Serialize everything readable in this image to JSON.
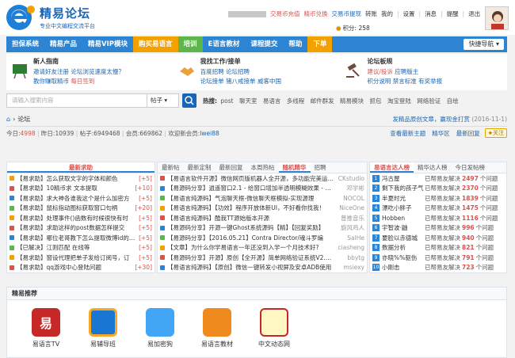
{
  "site": {
    "name": "精易论坛",
    "badge": "易",
    "tagline": "专业中文编程交流平台"
  },
  "toplinks": {
    "charge": "交易币充值",
    "exchange": "精币兑换",
    "rewards": "交易币提现",
    "label_switch": "转账",
    "mine": "我的",
    "settings": "设置",
    "messages": "消息",
    "remind": "提醒",
    "logout": "退出",
    "credits_label": "积分: 258"
  },
  "nav": [
    "担保系统",
    "精易产品",
    "精易VIP模块",
    "购买易语言",
    "培训",
    "E语言教材",
    "课程提交",
    "帮助",
    "下单"
  ],
  "quicknav": "快捷导航",
  "features": [
    {
      "title": "新人指南",
      "rows": [
        [
          "邀请好友注册",
          "论坛浏览速度太慢？"
        ],
        [
          "教你赚取精币",
          "每日签到"
        ]
      ]
    },
    {
      "title": "我找工作/接单",
      "rows": [
        [
          "百度招聘",
          "论坛招聘"
        ],
        [
          "论坛接单",
          "猪八戒接单",
          "威客中国"
        ]
      ]
    },
    {
      "title": "论坛板规",
      "rows": [
        [
          "建议/投诉",
          "应聘版主"
        ],
        [
          "积分说明",
          "禁言标准",
          "有奖举报"
        ]
      ]
    }
  ],
  "search": {
    "placeholder": "请输入搜索内容",
    "select": "帖子"
  },
  "hot": {
    "label": "热搜:",
    "items": [
      "post",
      "聊天室",
      "易语言",
      "多线程",
      "邮件群发",
      "精易模块",
      "抓包",
      "淘宝登陆",
      "网络验证",
      "自绘"
    ]
  },
  "crumb": {
    "home": "论坛",
    "notice": "发精品原创文章，赢现金打赏",
    "date": "(2016-11-1)"
  },
  "stats": {
    "today_label": "今日: ",
    "today": "4998",
    "yesterday_label": "昨日: ",
    "yesterday": "10939",
    "posts_label": "帖子: ",
    "posts": "6949468",
    "members_label": "会员: ",
    "members": "669862",
    "welcome": "欢迎新会员: ",
    "newest": "lwei88",
    "btn_digest": "查看最新主题",
    "btn_reply": "精华区",
    "btn_new": "最新回复",
    "follow": "关注"
  },
  "col1": {
    "tab": "最新求助",
    "rows": [
      [
        "【易求助】怎么获取文字的字体和颜色",
        "[+5]"
      ],
      [
        "【易求助】10精币求 文本提取",
        "[+10]"
      ],
      [
        "【易求助】求大神各谁我这个是什么加密方",
        "[+5]"
      ],
      [
        "【易求助】鼠标指动图标获取窗口句柄",
        "[+20]"
      ],
      [
        "【易求助】处理事件()函数有时候很快有时",
        "[+5]"
      ],
      [
        "【易求助】求助这样的post数据怎样提交",
        "[+5]"
      ],
      [
        "【易求助】哪位老哥教下怎么提取微博id的co",
        "[+5]"
      ],
      [
        "【已解决】江则匹配 在线等",
        "[+5]"
      ],
      [
        "【易求助】窗设代理把单子发给订阅号，订",
        "[+5]"
      ],
      [
        "【易求助】qq游戏中心登陆问题",
        "[+30]"
      ]
    ]
  },
  "col2": {
    "tabs": [
      "最新帖",
      "最新定制",
      "最新回复",
      "本周热帖",
      "随机精华",
      "招聘"
    ],
    "rows": [
      [
        "【易语言软件开源】微信网页版机器人全开源，多功能完美运行！",
        "CKstudio"
      ],
      [
        "【易源码分享】逍遥窗口2.1 - 给窗口增加半透明模糊效果 - 邓学彬",
        "邓学彬"
      ],
      [
        "【易语言纯源码】气泡聊天框-微信聊天框模拟-实现源理",
        "NOCOL"
      ],
      [
        "【易语言纯源码】【功效】程序开放体新UI，不好看你找我！",
        "NiceOne"
      ],
      [
        "【易语言纯源码】酷我TT源始版本开源",
        "普推音乐"
      ],
      [
        "【易源码分享】开源一键Ghost系统源码【精】【回复奖励】",
        "旋风鸡人"
      ],
      [
        "【易源码分享】【2016.05.21】Contra Director/魂斗罗编",
        "SalHe"
      ],
      [
        "【文章】为什么你学易语言一年还没到入学一个月技术好?",
        "ciasheng"
      ],
      [
        "【易源码分享】开源】原创【全开源】简单网络验证系统V2.0版",
        "bbytg"
      ],
      [
        "【易语言纯源码】【原创】微信一键转发小视屏及安卓ADB使用",
        "msiexy"
      ]
    ]
  },
  "col3": {
    "tabs": [
      "易语言达人榜",
      "精华达人榜",
      "今日发帖榜"
    ],
    "rows": [
      [
        "冯古屋",
        "已帮易友解决",
        "2497",
        "个问题"
      ],
      [
        "剩下我的孩子气",
        "已帮易友解决",
        "2370",
        "个问题"
      ],
      [
        "半夏时光",
        "已帮易友解决",
        "1839",
        "个问题"
      ],
      [
        "漂吃小胖子",
        "已帮易友解决",
        "1475",
        "个问题"
      ],
      [
        "Hobben",
        "已帮易友解决",
        "1116",
        "个问题"
      ],
      [
        "宇智波·鼬",
        "已帮易友解决",
        "996",
        "个问题"
      ],
      [
        "要脸以赤德城",
        "已帮易友解决",
        "940",
        "个问题"
      ],
      [
        "数据分析",
        "已帮易友解决",
        "821",
        "个问题"
      ],
      [
        "亦晓%%驱伤",
        "已帮易友解决",
        "791",
        "个问题"
      ],
      [
        "小刚击",
        "已帮易友解决",
        "723",
        "个问题"
      ]
    ]
  },
  "recommend": {
    "title": "精易推荐",
    "items": [
      "易语言TV",
      "易辅导班",
      "易加密狗",
      "易语言教材",
      "中文动态网"
    ]
  },
  "colors": {
    "nav": "#2d84d3",
    "accent": "#f2a100",
    "red": "#d9534f",
    "link": "#1766b8"
  }
}
